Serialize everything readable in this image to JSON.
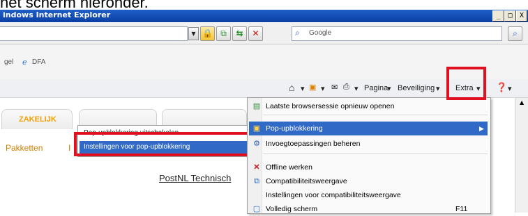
{
  "caption": "het scherm hieronder.",
  "titlebar": {
    "title": "indows Internet Explorer",
    "minimize": "_",
    "maximize": "□",
    "close": "X",
    "icon_color": "#0a3fa3"
  },
  "search": {
    "placeholder": "Google"
  },
  "favorites": {
    "item1": "gel",
    "item2": "DFA"
  },
  "commandbar": {
    "page": "Pagina",
    "safety": "Beveiliging",
    "tools": "Extra"
  },
  "page": {
    "tab_business": "ZAKELIJK",
    "pakketten": "Pakketten",
    "tab_partial": "I",
    "link": "PostNL Technisch"
  },
  "submenu": {
    "items": [
      "Pop-upblokkering uitschakelen",
      "Instellingen voor pop-upblokkering"
    ]
  },
  "menu": {
    "items": [
      "Laatste browsersessie opnieuw openen",
      "Pop-upblokkering",
      "Invoegtoepassingen beheren",
      "Offline werken",
      "Compatibiliteitsweergave",
      "Instellingen voor compatibiliteitsweergave",
      "Volledig scherm"
    ],
    "fullscreen_shortcut": "F11"
  },
  "colors": {
    "highlight_red": "#e01020",
    "menu_selected": "#3169c6",
    "accent_orange": "#f0a000"
  }
}
